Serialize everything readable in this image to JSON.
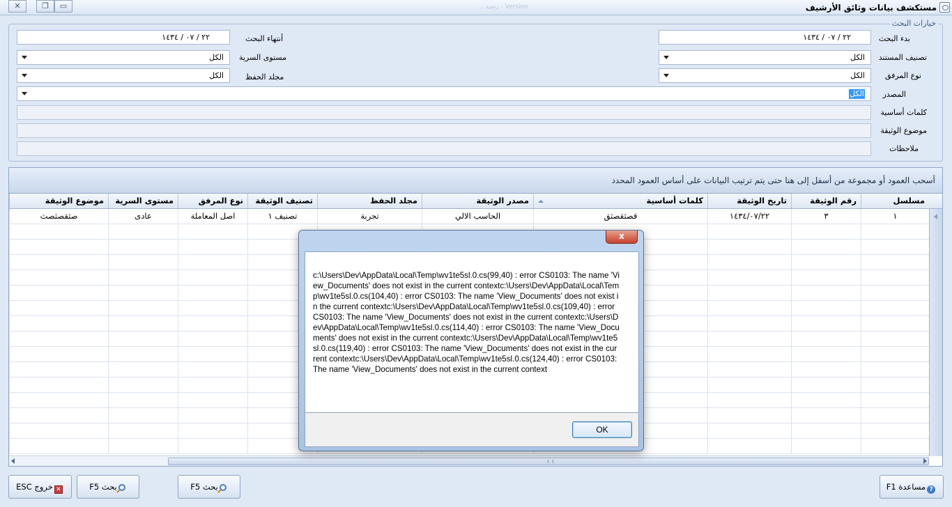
{
  "window": {
    "title": "مستكشف بيانات وثائق الأرشيف",
    "center_text": "... رسيد - Version"
  },
  "search": {
    "legend": "خيارات البحث",
    "start_label": "بدء البحث",
    "start_value": "٢٢ / ٠٧ / ١٤٣٤",
    "end_label": "أنتهاء البحث",
    "end_value": "٢٢ / ٠٧ / ١٤٣٤",
    "doc_class_label": "تصنيف المستند",
    "doc_class_value": "الكل",
    "secrecy_label": "مستوى السرية",
    "secrecy_value": "الكل",
    "attach_type_label": "نوع المرفق",
    "attach_type_value": "الكل",
    "folder_label": "مجلد الحفظ",
    "folder_value": "الكل",
    "source_label": "المصدر",
    "source_value": "الكل",
    "keywords_label": "كلمات أساسية",
    "subject_label": "موضوع الوثيقة",
    "notes_label": "ملاحظات"
  },
  "grid": {
    "group_hint": "أسحب العمود أو مجموعة من أسفل إلى هنا حتى يتم ترتيب البيانات على أساس العمود المحدد",
    "columns": [
      "مسلسل",
      "رقم الوثيقة",
      "تاريخ الوثيقة",
      "كلمات أساسية",
      "مصدر الوثيقة",
      "مجلد الحفظ",
      "تصنيف الوثيقة",
      "نوع المرفق",
      "مستوى السرية",
      "موضوع الوثيقة"
    ],
    "rows": [
      [
        "١",
        "٣",
        "١٤٣٤/٠٧/٢٢",
        "قصثقصثق",
        "الحاسب الالي",
        "تجربة",
        "تصنيف ١",
        "اصل المعاملة",
        "عادى",
        "صثقصثصث"
      ]
    ]
  },
  "buttons": {
    "help": "مساعدة F1",
    "search1": "بحث F5",
    "search2": "بحث F5",
    "exit": "خروج ESC"
  },
  "dialog": {
    "close": "x",
    "message": "c:\\Users\\Dev\\AppData\\Local\\Temp\\wv1te5sl.0.cs(99,40) : error CS0103: The name 'View_Documents' does not exist in the current contextc:\\Users\\Dev\\AppData\\Local\\Temp\\wv1te5sl.0.cs(104,40) : error CS0103: The name 'View_Documents' does not exist in the current contextc:\\Users\\Dev\\AppData\\Local\\Temp\\wv1te5sl.0.cs(109,40) : error CS0103: The name 'View_Documents' does not exist in the current contextc:\\Users\\Dev\\AppData\\Local\\Temp\\wv1te5sl.0.cs(114,40) : error CS0103: The name 'View_Documents' does not exist in the current contextc:\\Users\\Dev\\AppData\\Local\\Temp\\wv1te5sl.0.cs(119,40) : error CS0103: The name 'View_Documents' does not exist in the current contextc:\\Users\\Dev\\AppData\\Local\\Temp\\wv1te5sl.0.cs(124,40) : error CS0103: The name 'View_Documents' does not exist in the current context",
    "ok": "OK"
  }
}
